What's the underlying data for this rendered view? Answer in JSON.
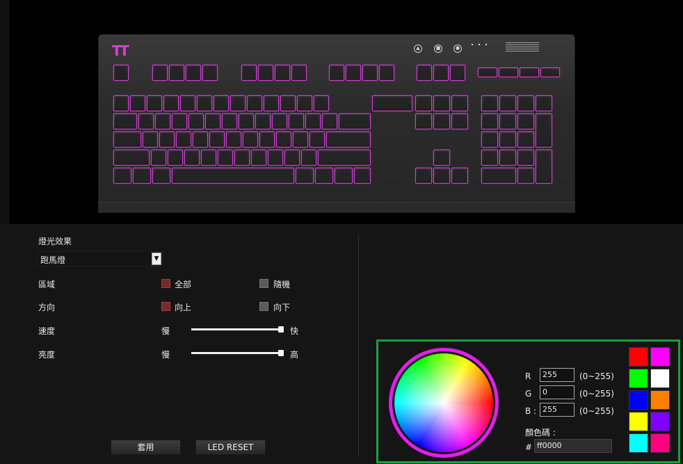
{
  "keyboard": {
    "logo": "TT",
    "accent": "#d23cd6"
  },
  "settings": {
    "effect_label": "燈光效果",
    "effect_value": "跑馬燈",
    "zone_label": "區域",
    "zone_opt_all": "全部",
    "zone_opt_random": "隨機",
    "zone_selected": "全部",
    "direction_label": "方向",
    "direction_opt_up": "向上",
    "direction_opt_down": "向下",
    "direction_selected": "向上",
    "speed_label": "速度",
    "speed_slow": "慢",
    "speed_fast": "快",
    "speed_level": 1.0,
    "brightness_label": "亮度",
    "brightness_low": "慢",
    "brightness_high": "高",
    "brightness_level": 1.0,
    "apply_button": "套用",
    "reset_button": "LED RESET"
  },
  "color": {
    "r_label": "R",
    "g_label": "G",
    "b_label": "B :",
    "r_value": "255",
    "g_value": "0",
    "b_value": "255",
    "range_hint": "(0~255)",
    "code_label": "顏色碼 :",
    "hash": "#",
    "hex_value": "ff0000",
    "swatches": [
      "#ff0000",
      "#ff00ff",
      "#00ff00",
      "#ffffff",
      "#0000ff",
      "#ff8000",
      "#ffff00",
      "#8000ff",
      "#00ffff",
      "#ff0080"
    ]
  }
}
